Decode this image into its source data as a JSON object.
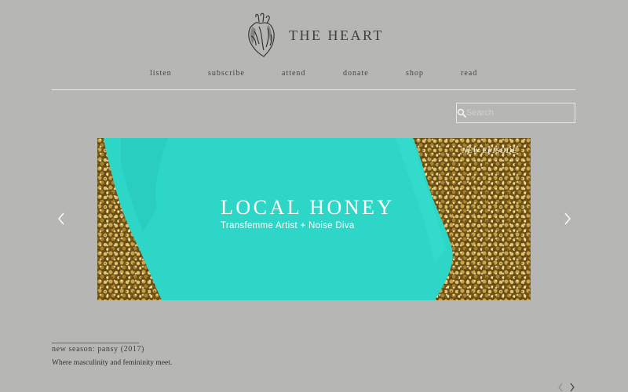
{
  "header": {
    "site_title": "THE HEART"
  },
  "nav": {
    "items": [
      {
        "label": "listen"
      },
      {
        "label": "subscribe"
      },
      {
        "label": "attend"
      },
      {
        "label": "donate"
      },
      {
        "label": "shop"
      },
      {
        "label": "read"
      }
    ]
  },
  "search": {
    "placeholder": "Search",
    "value": ""
  },
  "slider": {
    "badge": "NEW EPISODE",
    "title": "LOCAL HONEY",
    "subtitle": "Transfemme Artist + Noise Diva",
    "colors": {
      "accent": "#2ed6c7",
      "glitter": "#8a6a25"
    }
  },
  "season": {
    "title": "new season: pansy (2017)",
    "description": "Where masculinity and femininity meet."
  },
  "icons": {
    "logo": "anatomical-heart-icon",
    "search": "search-icon",
    "prev": "chevron-left-icon",
    "next": "chevron-right-icon"
  }
}
